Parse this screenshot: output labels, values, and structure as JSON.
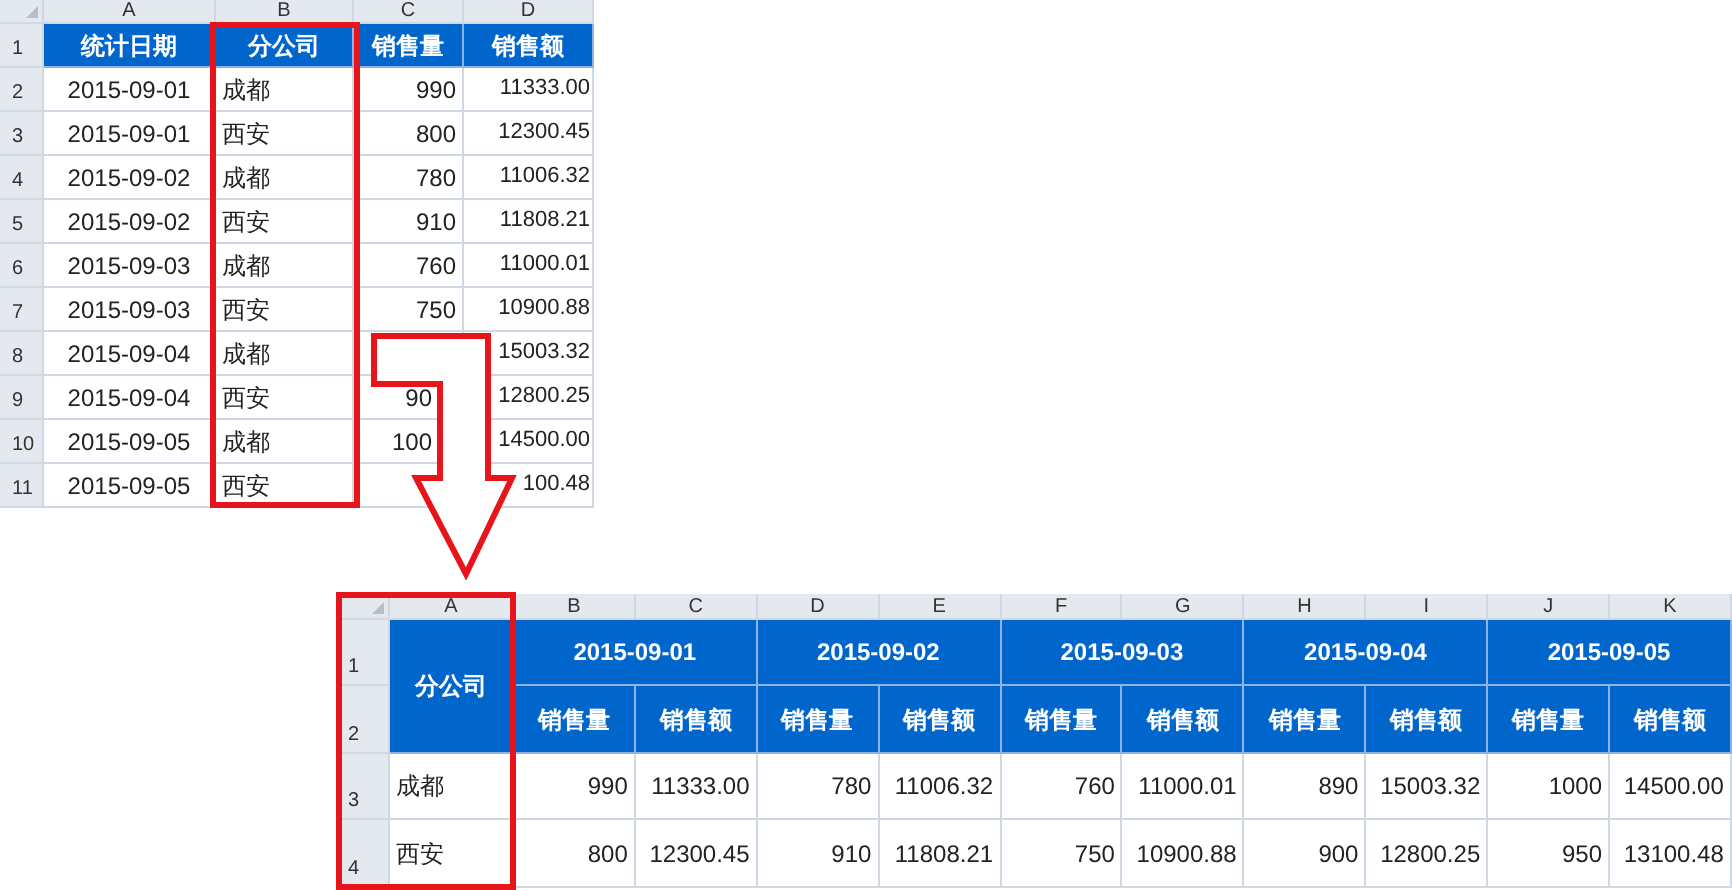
{
  "top_sheet": {
    "column_letters": [
      "A",
      "B",
      "C",
      "D"
    ],
    "row_numbers": [
      "1",
      "2",
      "3",
      "4",
      "5",
      "6",
      "7",
      "8",
      "9",
      "10",
      "11"
    ],
    "header": [
      "统计日期",
      "分公司",
      "销售量",
      "销售额"
    ],
    "rows": [
      [
        "2015-09-01",
        "成都",
        "990",
        "11333.00"
      ],
      [
        "2015-09-01",
        "西安",
        "800",
        "12300.45"
      ],
      [
        "2015-09-02",
        "成都",
        "780",
        "11006.32"
      ],
      [
        "2015-09-02",
        "西安",
        "910",
        "11808.21"
      ],
      [
        "2015-09-03",
        "成都",
        "760",
        "11000.01"
      ],
      [
        "2015-09-03",
        "西安",
        "750",
        "10900.88"
      ],
      [
        "2015-09-04",
        "成都",
        null,
        "15003.32"
      ],
      [
        "2015-09-04",
        "西安",
        "90",
        "12800.25"
      ],
      [
        "2015-09-05",
        "成都",
        "100",
        "14500.00"
      ],
      [
        "2015-09-05",
        "西安",
        null,
        "100.48"
      ]
    ]
  },
  "bottom_sheet": {
    "column_letters": [
      "A",
      "B",
      "C",
      "D",
      "E",
      "F",
      "G",
      "H",
      "I",
      "J",
      "K"
    ],
    "row_numbers": [
      "1",
      "2",
      "3",
      "4"
    ],
    "corner_header": "分公司",
    "dates": [
      "2015-09-01",
      "2015-09-02",
      "2015-09-03",
      "2015-09-04",
      "2015-09-05"
    ],
    "subheaders": [
      "销售量",
      "销售额",
      "销售量",
      "销售额",
      "销售量",
      "销售额",
      "销售量",
      "销售额",
      "销售量",
      "销售额"
    ],
    "rows": [
      {
        "branch": "成都",
        "cells": [
          "990",
          "11333.00",
          "780",
          "11006.32",
          "760",
          "11000.01",
          "890",
          "15003.32",
          "1000",
          "14500.00"
        ]
      },
      {
        "branch": "西安",
        "cells": [
          "800",
          "12300.45",
          "910",
          "11808.21",
          "750",
          "10900.88",
          "900",
          "12800.25",
          "950",
          "13100.48"
        ]
      }
    ]
  }
}
